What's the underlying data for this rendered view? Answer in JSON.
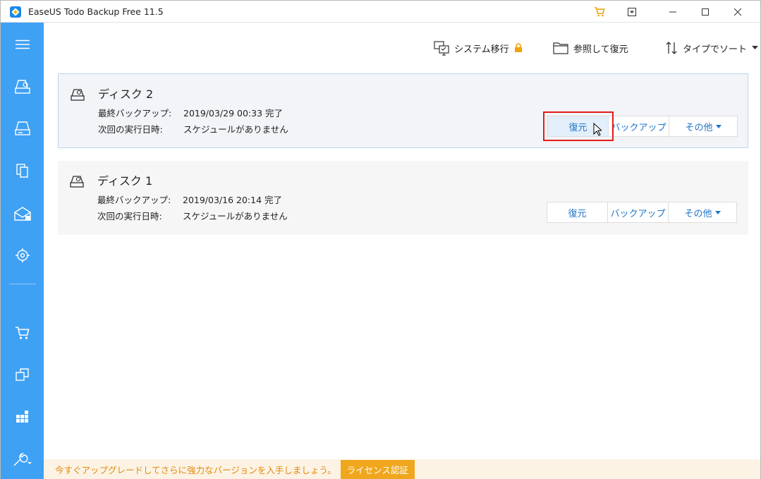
{
  "window": {
    "title": "EaseUS Todo Backup Free 11.5",
    "controls": {
      "minimize": "─",
      "maximize": "☐",
      "close": "✕",
      "dropdown": "⊡"
    }
  },
  "sidebar": {
    "items": [
      "menu-icon",
      "disk-backup-icon",
      "partition-backup-icon",
      "file-backup-icon",
      "mail-backup-icon",
      "smart-backup-icon",
      "cart-icon",
      "clone-icon",
      "system-transfer-icon",
      "tools-icon"
    ],
    "accent": "#3fa1f3"
  },
  "toolbar": {
    "migrate_label": "システム移行",
    "browse_label": "参照して復元",
    "sort_label": "タイプでソート"
  },
  "cards": [
    {
      "title": "ディスク 2",
      "last_backup_label": "最終バックアップ:",
      "last_backup_value": "2019/03/29 00:33 完了",
      "next_run_label": "次回の実行日時:",
      "next_run_value": "スケジュールがありません",
      "restore_label": "復元",
      "backup_label": "バックアップ",
      "more_label": "その他"
    },
    {
      "title": "ディスク 1",
      "last_backup_label": "最終バックアップ:",
      "last_backup_value": "2019/03/16 20:14 完了",
      "next_run_label": "次回の実行日時:",
      "next_run_value": "スケジュールがありません",
      "restore_label": "復元",
      "backup_label": "バックアップ",
      "more_label": "その他"
    }
  ],
  "promo": {
    "text": "今すぐアップグレードしてさらに強力なバージョンを入手しましょう。",
    "button": "ライセンス認証"
  },
  "colors": {
    "link": "#1f74c8",
    "highlight": "#e31b1b",
    "promo": "#f0a71e"
  }
}
